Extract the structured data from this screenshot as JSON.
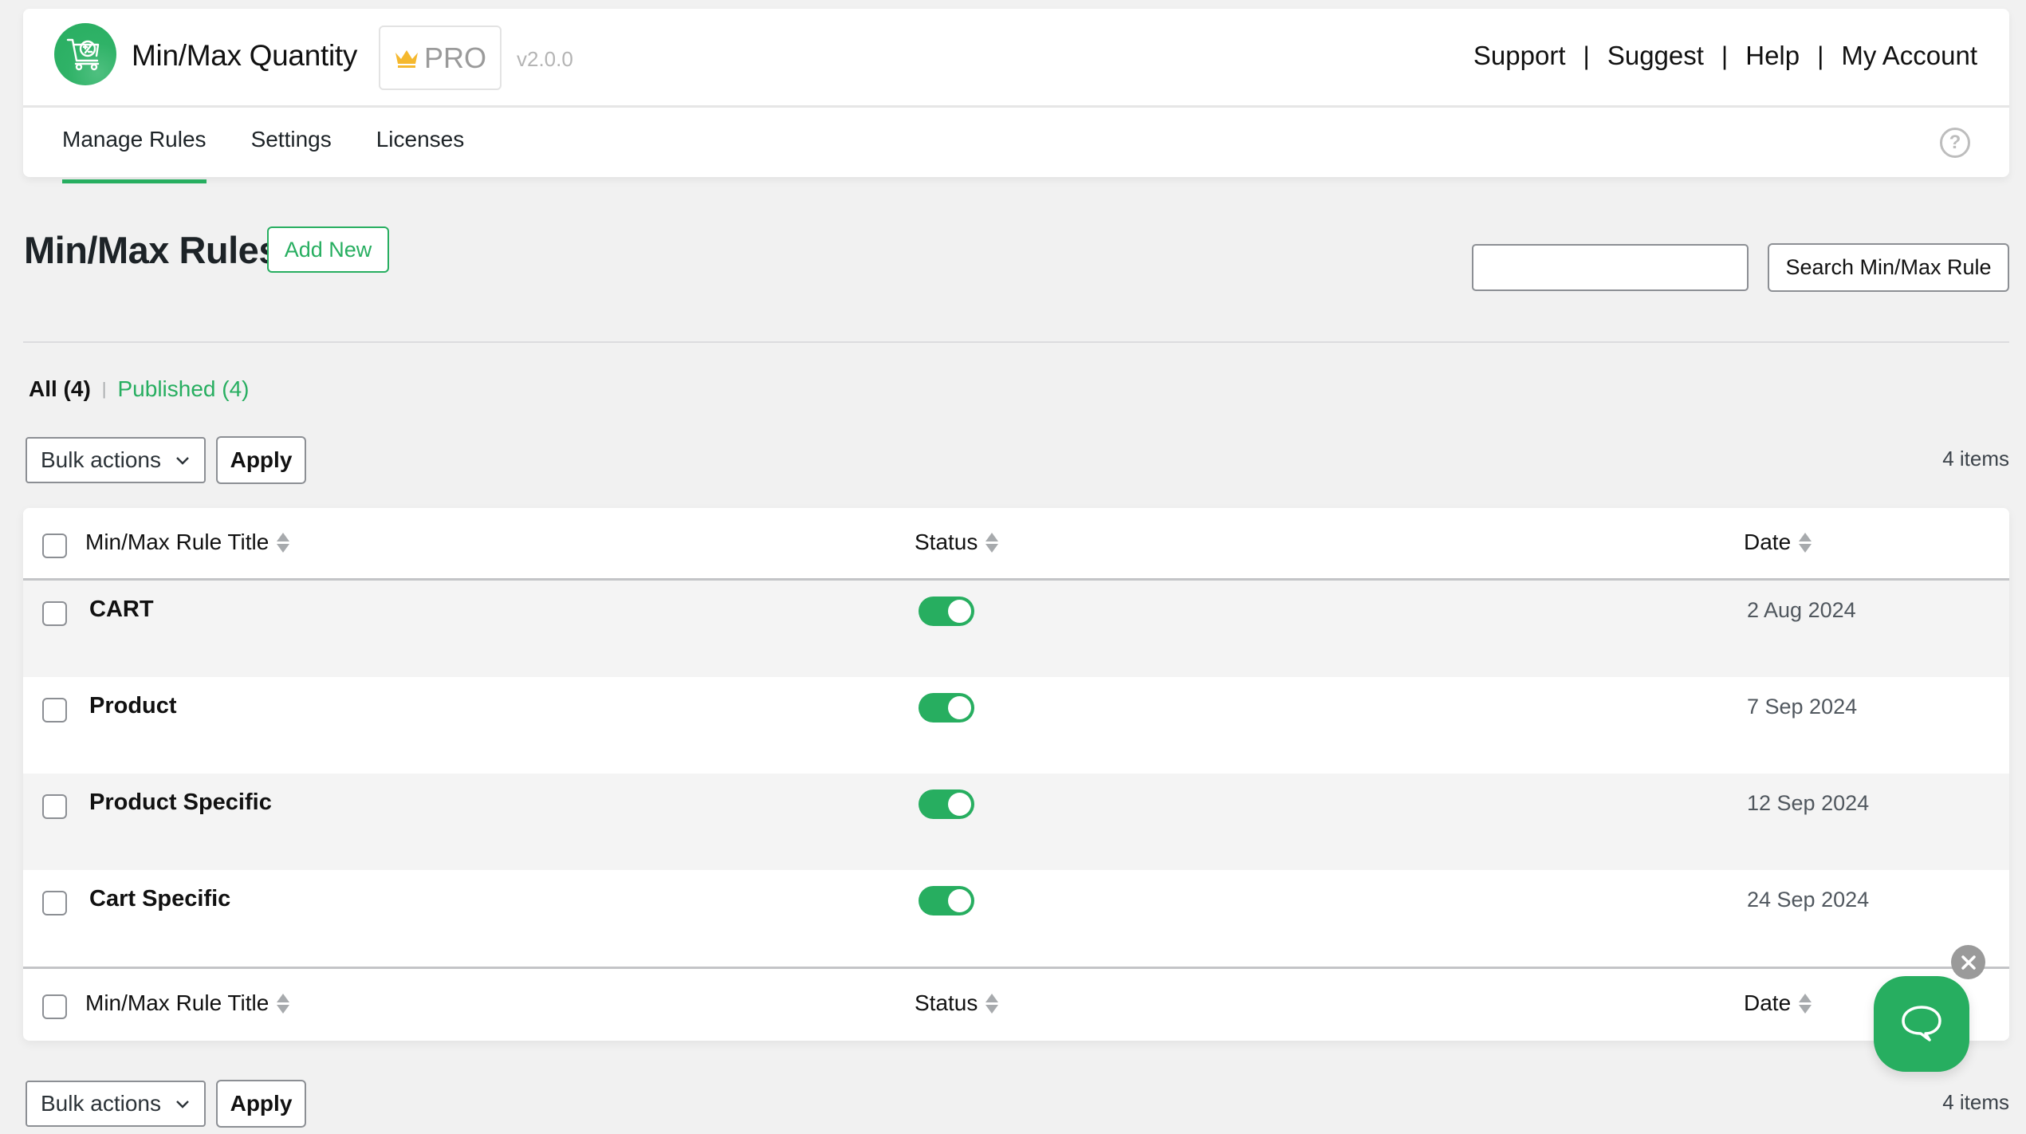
{
  "header": {
    "app_title": "Min/Max Quantity",
    "pro_label": "PRO",
    "version": "v2.0.0",
    "links": [
      "Support",
      "Suggest",
      "Help",
      "My Account"
    ],
    "link_separator": "|",
    "help_glyph": "?"
  },
  "tabs": [
    {
      "label": "Manage Rules",
      "active": true
    },
    {
      "label": "Settings",
      "active": false
    },
    {
      "label": "Licenses",
      "active": false
    }
  ],
  "page": {
    "title": "Min/Max Rules",
    "add_new_label": "Add New",
    "search_value": "",
    "search_button_label": "Search Min/Max Rule"
  },
  "filters": {
    "all_label": "All (4)",
    "separator": "|",
    "published_label": "Published (4)"
  },
  "bulk": {
    "select_label": "Bulk actions",
    "apply_label": "Apply",
    "items_count": "4 items"
  },
  "table": {
    "columns": {
      "title": "Min/Max Rule Title",
      "status": "Status",
      "date": "Date"
    },
    "rows": [
      {
        "title": "CART",
        "status_enabled": true,
        "date": "2 Aug 2024"
      },
      {
        "title": "Product",
        "status_enabled": true,
        "date": "7 Sep 2024"
      },
      {
        "title": "Product Specific",
        "status_enabled": true,
        "date": "12 Sep 2024"
      },
      {
        "title": "Cart Specific",
        "status_enabled": true,
        "date": "24 Sep 2024"
      }
    ]
  },
  "colors": {
    "accent": "#27ae60",
    "crown": "#f5b82e",
    "background": "#f1f1f1"
  },
  "icons": {
    "logo": "cart-plus-minus-icon",
    "crown": "crown-icon",
    "help": "question-circle-icon",
    "chat": "chat-bubble-icon",
    "close": "close-icon",
    "sort": "sort-arrows-icon",
    "dropdown": "chevron-down-icon"
  }
}
